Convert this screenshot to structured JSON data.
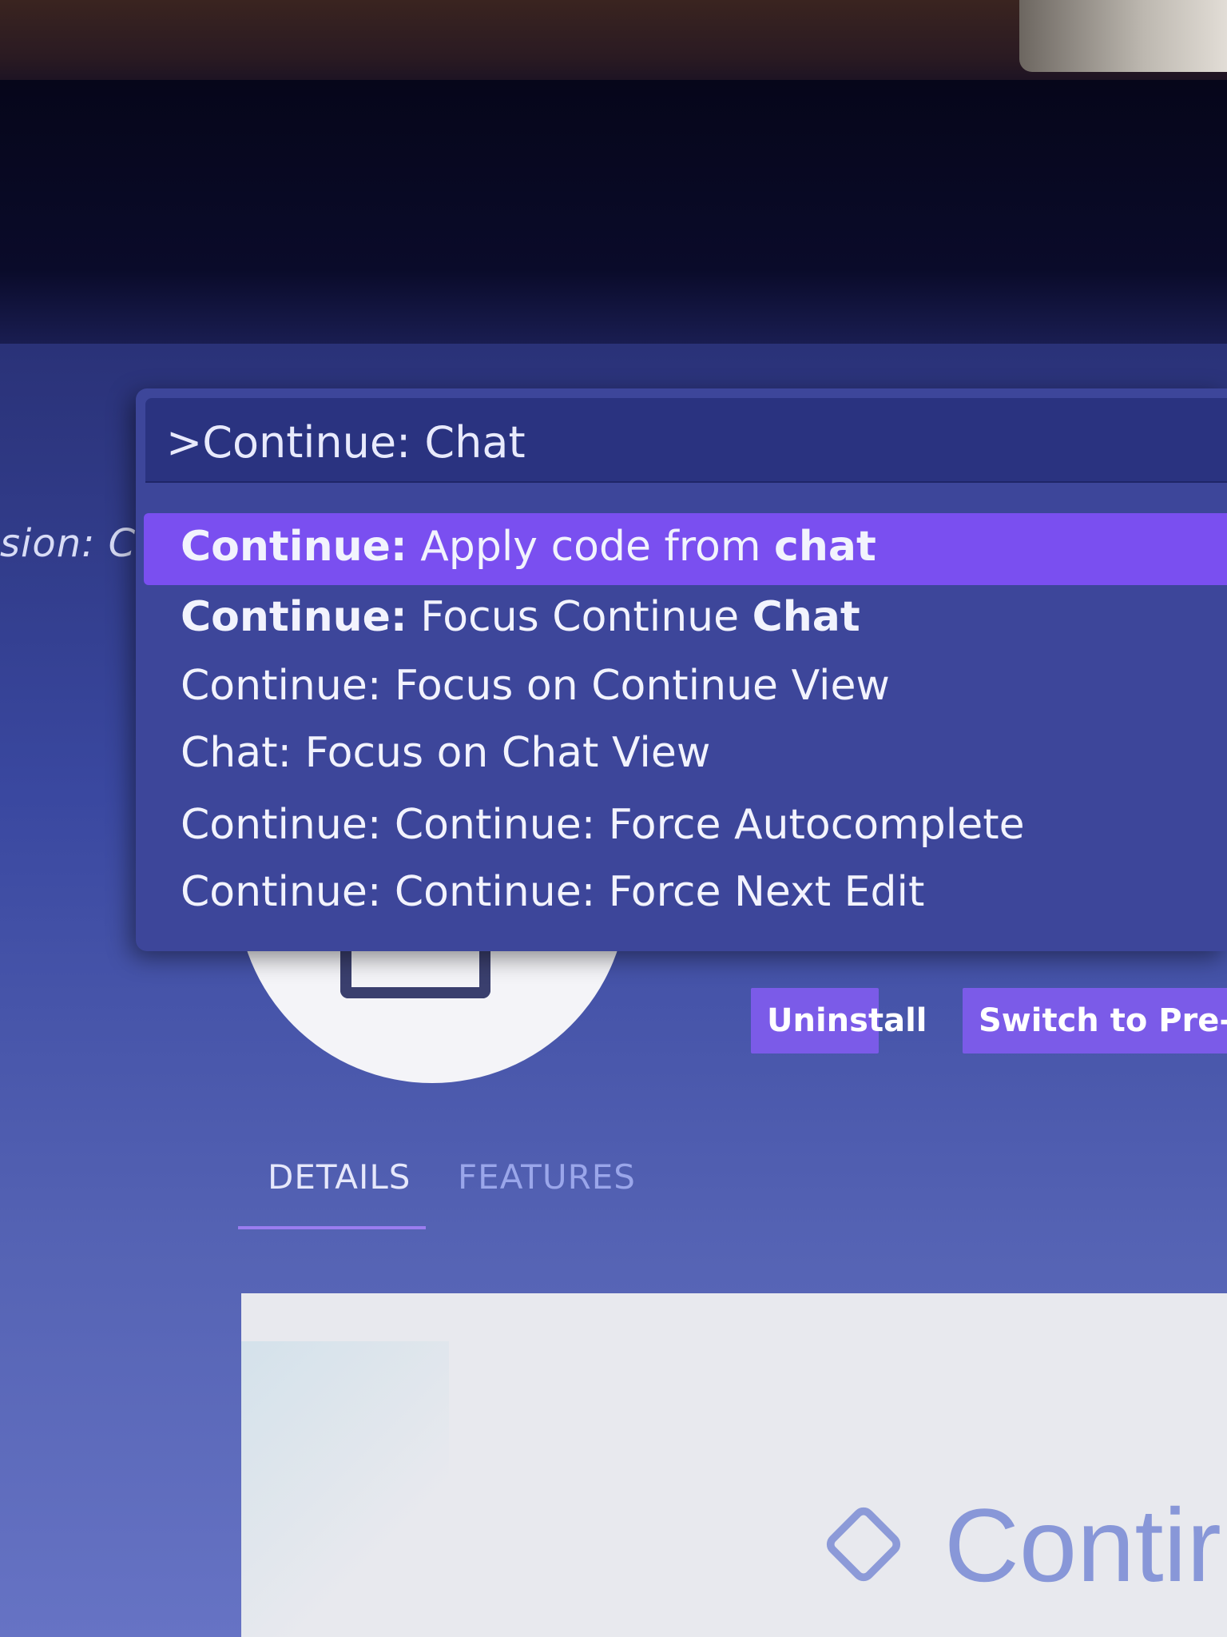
{
  "editor": {
    "left_fragment": "sion: C"
  },
  "command_palette": {
    "query": ">Continue: Chat",
    "items": [
      {
        "prefix": "Continue:",
        "middle": " Apply code from ",
        "suffix": "chat",
        "selected": true
      },
      {
        "prefix": "Continue:",
        "middle": " Focus Continue ",
        "suffix": "Chat",
        "selected": false
      },
      {
        "prefix": "",
        "middle": "Continue: Focus on Continue View",
        "suffix": "",
        "selected": false
      },
      {
        "prefix": "",
        "middle": "Chat: Focus on Chat View",
        "suffix": "",
        "selected": false
      },
      {
        "prefix": "",
        "middle": "Continue: Continue: Force Autocomplete",
        "suffix": "",
        "selected": false
      },
      {
        "prefix": "",
        "middle": "Continue: Continue: Force Next Edit",
        "suffix": "",
        "selected": false
      }
    ],
    "selected_color": "#7a4ff0"
  },
  "extension": {
    "buttons": {
      "uninstall": "Uninstall",
      "switch_prerelease": "Switch to Pre-Re"
    },
    "tabs": {
      "details": "DETAILS",
      "features": "FEATURES",
      "active": "details"
    },
    "preview_text": "Contir"
  },
  "colors": {
    "accent": "#7b5be8",
    "palette_bg": "#3d469a",
    "screen_bg": "#3a48a0"
  }
}
